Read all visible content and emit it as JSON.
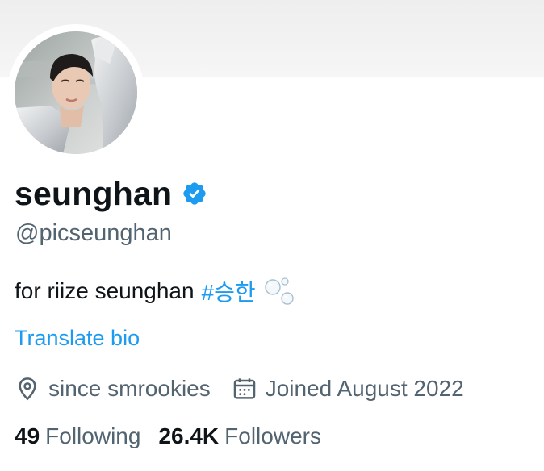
{
  "profile": {
    "display_name": "seunghan",
    "handle": "@picseunghan",
    "bio_text": "for riize seunghan",
    "bio_hashtag": "#승한",
    "translate_label": "Translate bio",
    "location": "since smrookies",
    "joined": "Joined August 2022",
    "following_count": "49",
    "following_label": "Following",
    "followers_count": "26.4K",
    "followers_label": "Followers"
  },
  "icons": {
    "verified": "verified-badge-icon",
    "bio_emoji": "bubbles-icon",
    "location": "location-pin-icon",
    "joined": "calendar-icon"
  },
  "colors": {
    "accent": "#1d9bf0",
    "secondary_text": "#536471",
    "primary_text": "#0f1419"
  }
}
